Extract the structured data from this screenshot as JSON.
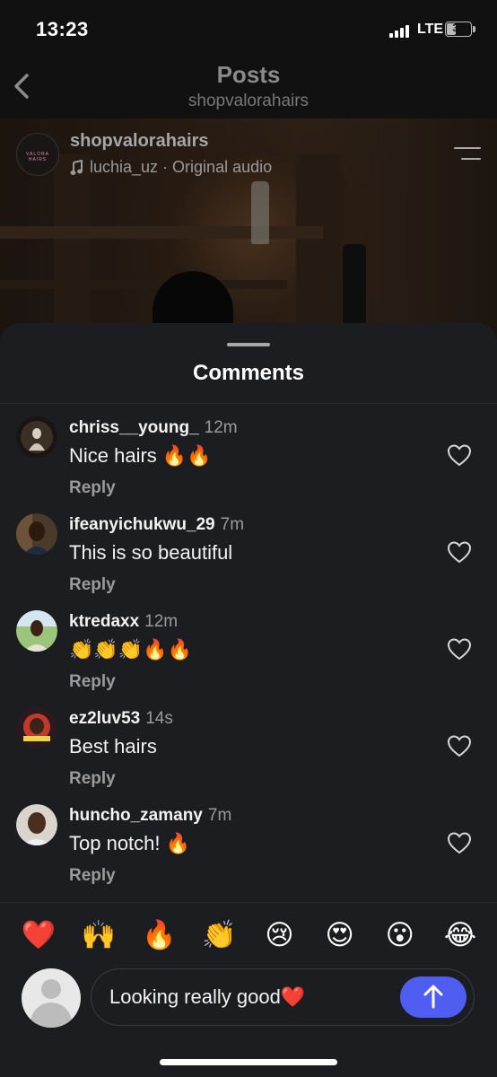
{
  "status_bar": {
    "time": "13:23",
    "network": "LTE",
    "battery": "34"
  },
  "header": {
    "title": "Posts",
    "subtitle": "shopvalorahairs"
  },
  "post": {
    "username": "shopvalorahairs",
    "audio": "luchia_uz · Original audio",
    "avatar_text": "VALORA HAIRS"
  },
  "comments_sheet": {
    "title": "Comments",
    "comments": [
      {
        "username": "chriss__young_",
        "time": "12m",
        "text": "Nice hairs 🔥🔥",
        "reply": "Reply"
      },
      {
        "username": "ifeanyichukwu_29",
        "time": "7m",
        "text": "This is so beautiful",
        "reply": "Reply"
      },
      {
        "username": "ktredaxx",
        "time": "12m",
        "text": "👏👏👏🔥🔥",
        "reply": "Reply"
      },
      {
        "username": "ez2luv53",
        "time": "14s",
        "text": "Best hairs",
        "reply": "Reply"
      },
      {
        "username": "huncho_zamany",
        "time": "7m",
        "text": "Top notch! 🔥",
        "reply": "Reply"
      }
    ]
  },
  "reactions": [
    "❤️",
    "🙌",
    "🔥",
    "👏",
    "😢",
    "😍",
    "😮",
    "😂"
  ],
  "composer": {
    "value": "Looking really good❤️"
  },
  "colors": {
    "send_button": "#4f5ef0",
    "sheet_bg": "#1c1d20"
  }
}
